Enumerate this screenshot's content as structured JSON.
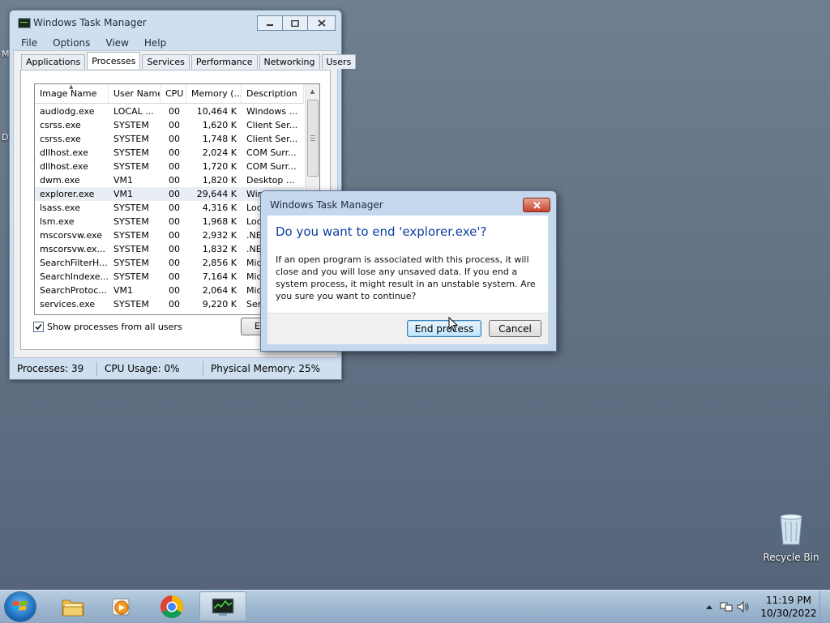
{
  "taskmgr": {
    "title": "Windows Task Manager",
    "menu": [
      "File",
      "Options",
      "View",
      "Help"
    ],
    "tabs": [
      "Applications",
      "Processes",
      "Services",
      "Performance",
      "Networking",
      "Users"
    ],
    "active_tab": "Processes",
    "columns": [
      "Image Name",
      "User Name",
      "CPU",
      "Memory (...",
      "Description"
    ],
    "processes": [
      {
        "image": "audiodg.exe",
        "user": "LOCAL ...",
        "cpu": "00",
        "mem": "10,464 K",
        "desc": "Windows ..."
      },
      {
        "image": "csrss.exe",
        "user": "SYSTEM",
        "cpu": "00",
        "mem": "1,620 K",
        "desc": "Client Ser..."
      },
      {
        "image": "csrss.exe",
        "user": "SYSTEM",
        "cpu": "00",
        "mem": "1,748 K",
        "desc": "Client Ser..."
      },
      {
        "image": "dllhost.exe",
        "user": "SYSTEM",
        "cpu": "00",
        "mem": "2,024 K",
        "desc": "COM Surr..."
      },
      {
        "image": "dllhost.exe",
        "user": "SYSTEM",
        "cpu": "00",
        "mem": "1,720 K",
        "desc": "COM Surr..."
      },
      {
        "image": "dwm.exe",
        "user": "VM1",
        "cpu": "00",
        "mem": "1,820 K",
        "desc": "Desktop ..."
      },
      {
        "image": "explorer.exe",
        "user": "VM1",
        "cpu": "00",
        "mem": "29,644 K",
        "desc": "Win"
      },
      {
        "image": "lsass.exe",
        "user": "SYSTEM",
        "cpu": "00",
        "mem": "4,316 K",
        "desc": "Loc"
      },
      {
        "image": "lsm.exe",
        "user": "SYSTEM",
        "cpu": "00",
        "mem": "1,968 K",
        "desc": "Loc"
      },
      {
        "image": "mscorsvw.exe",
        "user": "SYSTEM",
        "cpu": "00",
        "mem": "2,932 K",
        "desc": ".NE"
      },
      {
        "image": "mscorsvw.ex...",
        "user": "SYSTEM",
        "cpu": "00",
        "mem": "1,832 K",
        "desc": ".NE"
      },
      {
        "image": "SearchFilterH...",
        "user": "SYSTEM",
        "cpu": "00",
        "mem": "2,856 K",
        "desc": "Mic"
      },
      {
        "image": "SearchIndexe...",
        "user": "SYSTEM",
        "cpu": "00",
        "mem": "7,164 K",
        "desc": "Mic"
      },
      {
        "image": "SearchProtoc...",
        "user": "VM1",
        "cpu": "00",
        "mem": "2,064 K",
        "desc": "Mic"
      },
      {
        "image": "services.exe",
        "user": "SYSTEM",
        "cpu": "00",
        "mem": "9,220 K",
        "desc": "Ser"
      }
    ],
    "selected_index": 6,
    "show_all_label": "Show processes from all users",
    "show_all_checked": true,
    "end_button_label": "E",
    "status": {
      "processes": "Processes: 39",
      "cpu": "CPU Usage: 0%",
      "memory": "Physical Memory: 25%"
    }
  },
  "dialog": {
    "title": "Windows Task Manager",
    "heading": "Do you want to end 'explorer.exe'?",
    "message": "If an open program is associated with this process, it will close and you will lose any unsaved data. If you end a system process, it might result in an unstable system. Are you sure you want to continue?",
    "end_label": "End process",
    "cancel_label": "Cancel"
  },
  "desktop": {
    "recycle_bin_label": "Recycle Bin",
    "edge_letters": [
      "M",
      "D"
    ],
    "wallpaper_note": ""
  },
  "taskbar": {
    "pinned": [
      "explorer-folder-icon",
      "media-player-icon",
      "chrome-icon",
      "task-manager-icon"
    ],
    "active": "task-manager-icon",
    "time": "11:19 PM",
    "date": "10/30/2022"
  },
  "colors": {
    "accent": "#0b3ea3",
    "close_red": "#c7422c",
    "taskbar": "#9fb9d1"
  }
}
